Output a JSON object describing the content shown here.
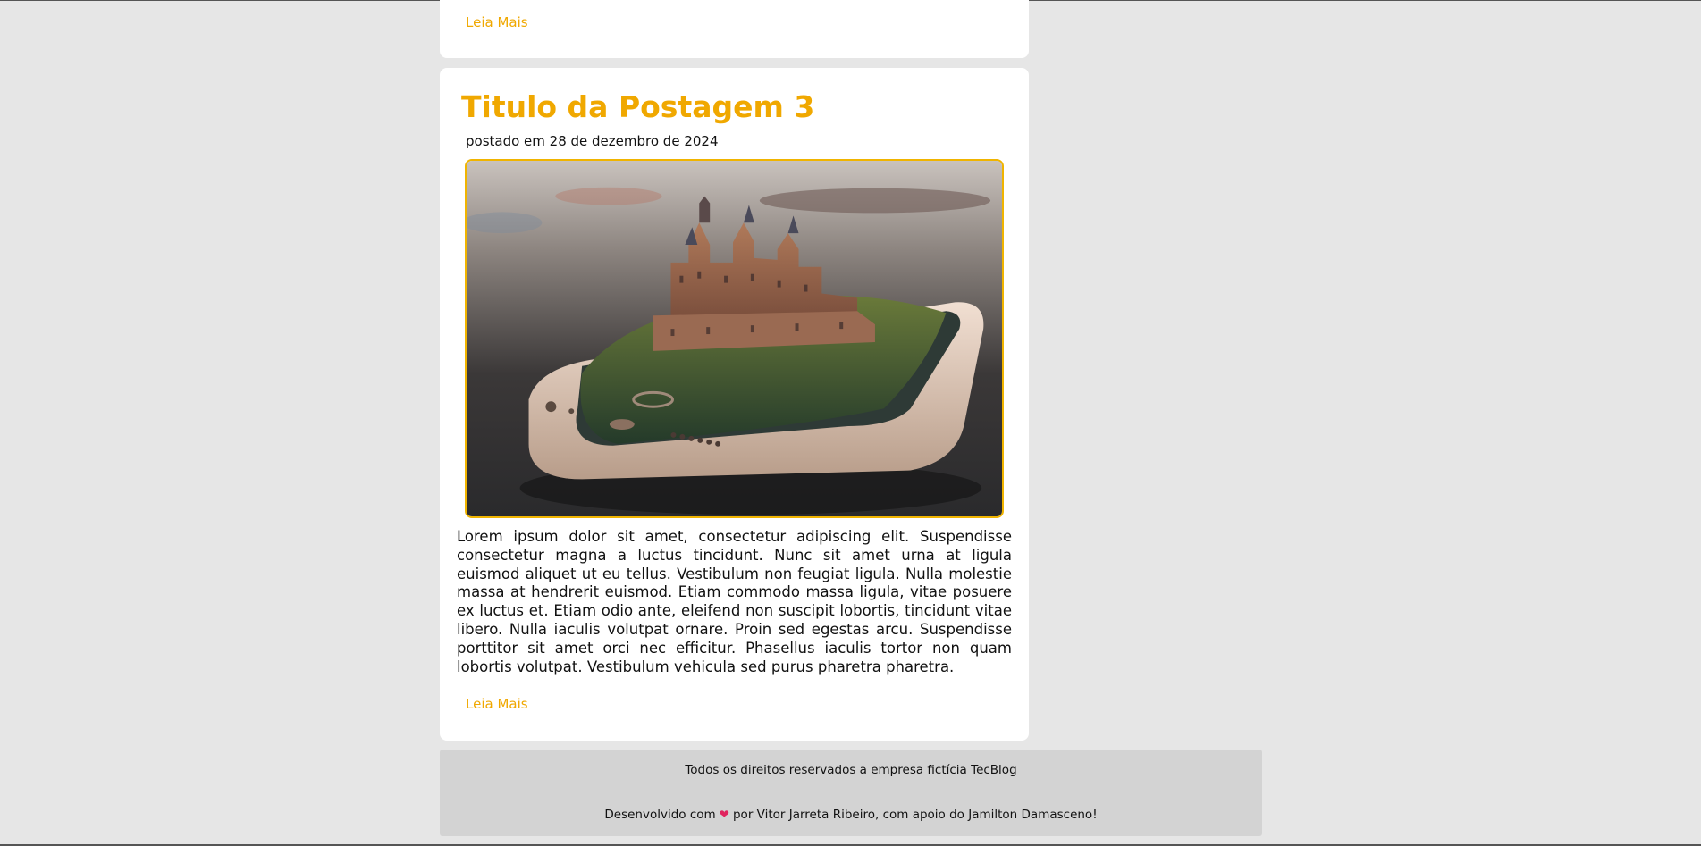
{
  "previous_post": {
    "read_more_label": "Leia Mais"
  },
  "post": {
    "title": "Titulo da Postagem 3",
    "date": "postado em 28 de dezembro de 2024",
    "body": "Lorem ipsum dolor sit amet, consectetur adipiscing elit. Suspendisse consectetur magna a luctus tincidunt. Nunc sit amet urna at ligula euismod aliquet ut eu tellus. Vestibulum non feugiat ligula. Nulla molestie massa at hendrerit euismod. Etiam commodo massa ligula, vitae posuere ex luctus et. Etiam odio ante, eleifend non suscipit lobortis, tincidunt vitae libero. Nulla iaculis volutpat ornare. Proin sed egestas arcu. Suspendisse porttitor sit amet orci nec efficitur. Phasellus iaculis tortor non quam lobortis volutpat. Vestibulum vehicula sed purus pharetra pharetra.",
    "read_more_label": "Leia Mais",
    "image_icon": "castle-on-smartphone-image"
  },
  "footer": {
    "copyright": "Todos os direitos reservados a empresa fictícia TecBlog",
    "credits_prefix": "Desenvolvido com",
    "credits_icon": "heart-icon",
    "credits_suffix": "por Vitor Jarreta Ribeiro, com apoio do Jamilton Damasceno!"
  },
  "colors": {
    "accent": "#f0a800",
    "page_background": "#e6e6e6",
    "card_background": "#ffffff",
    "footer_background": "#d3d3d3",
    "heart": "#e0245e"
  }
}
